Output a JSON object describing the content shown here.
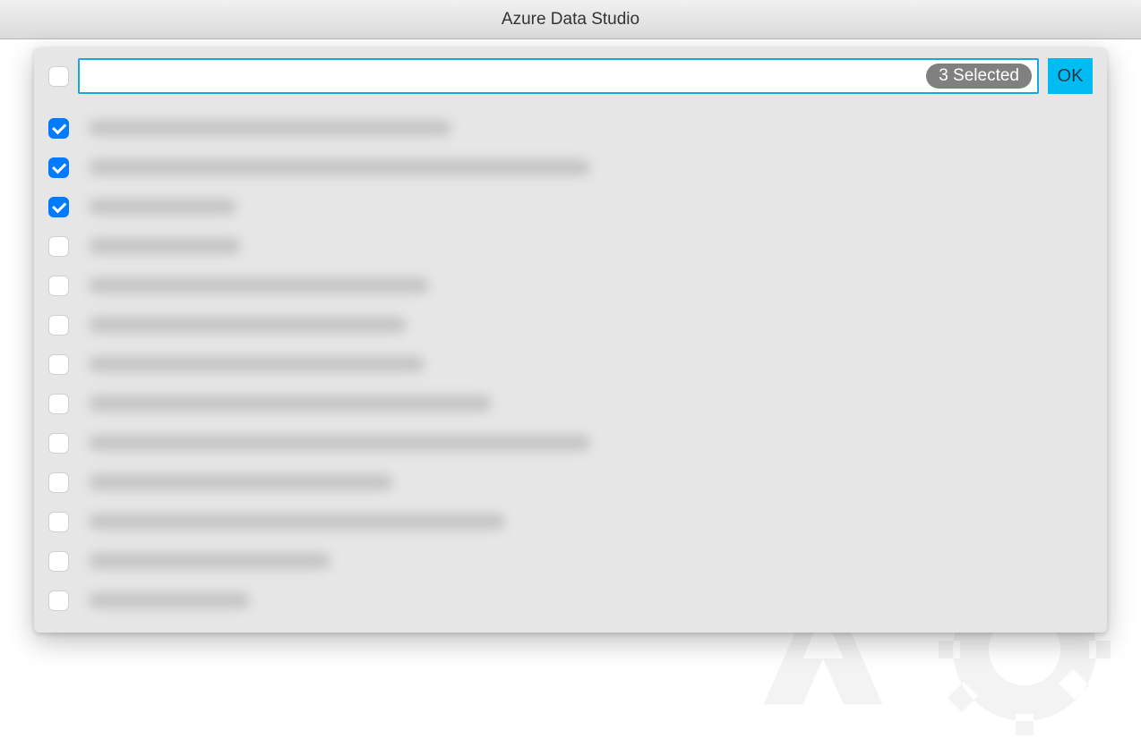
{
  "window": {
    "title": "Azure Data Studio"
  },
  "picker": {
    "select_all_checked": false,
    "search_value": "",
    "search_placeholder": "",
    "selected_badge": "3 Selected",
    "ok_label": "OK",
    "items": [
      {
        "checked": true,
        "label_width": 405
      },
      {
        "checked": true,
        "label_width": 560
      },
      {
        "checked": true,
        "label_width": 165
      },
      {
        "checked": false,
        "label_width": 170
      },
      {
        "checked": false,
        "label_width": 380
      },
      {
        "checked": false,
        "label_width": 355
      },
      {
        "checked": false,
        "label_width": 375
      },
      {
        "checked": false,
        "label_width": 450
      },
      {
        "checked": false,
        "label_width": 560
      },
      {
        "checked": false,
        "label_width": 340
      },
      {
        "checked": false,
        "label_width": 465
      },
      {
        "checked": false,
        "label_width": 270
      },
      {
        "checked": false,
        "label_width": 180
      }
    ]
  }
}
